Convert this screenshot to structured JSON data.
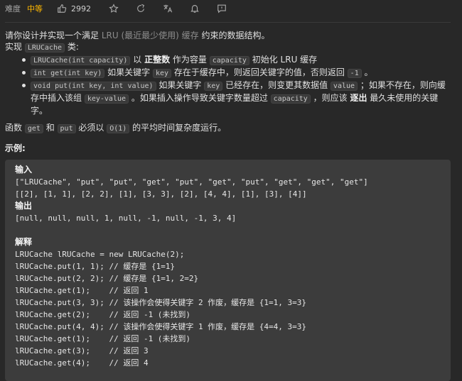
{
  "toolbar": {
    "difficulty_label": "难度",
    "difficulty_value": "中等",
    "likes": "2992",
    "icons": [
      "thumb-up-icon",
      "star-icon",
      "share-icon",
      "translate-icon",
      "bell-icon",
      "feedback-icon"
    ]
  },
  "description": {
    "l1_a": "请你设计并实现一个满足 ",
    "l1_b": "LRU (最近最少使用) 缓存",
    "l1_c": " 约束的数据结构。",
    "l2_a": "实现 ",
    "l2_code": "LRUCache",
    "l2_b": " 类:",
    "b1_code1": "LRUCache(int capacity)",
    "b1_a": " 以 ",
    "b1_bold": "正整数",
    "b1_b": " 作为容量 ",
    "b1_code2": "capacity",
    "b1_c": " 初始化 LRU 缓存",
    "b2_code1": "int get(int key)",
    "b2_a": " 如果关键字 ",
    "b2_code2": "key",
    "b2_b": " 存在于缓存中，则返回关键字的值，否则返回 ",
    "b2_code3": "-1",
    "b2_c": " 。",
    "b3_code1": "void put(int key, int value)",
    "b3_a": " 如果关键字 ",
    "b3_code2": "key",
    "b3_b": " 已经存在，则变更其数据值 ",
    "b3_code3": "value",
    "b3_c": " ；如果不存在，则向缓存中插入该组 ",
    "b3_code4": "key-value",
    "b3_d": " 。如果插入操作导致关键字数量超过 ",
    "b3_code5": "capacity",
    "b3_e": " ，则应该 ",
    "b3_bold": "逐出",
    "b3_f": " 最久未使用的关键字。",
    "l4_a": "函数 ",
    "l4_code1": "get",
    "l4_b": " 和 ",
    "l4_code2": "put",
    "l4_c": " 必须以 ",
    "l4_code3": "O(1)",
    "l4_d": " 的平均时间复杂度运行。"
  },
  "example": {
    "title": "示例:",
    "input_heading": "输入",
    "input_line1": "[\"LRUCache\", \"put\", \"put\", \"get\", \"put\", \"get\", \"put\", \"get\", \"get\", \"get\"]",
    "input_line2": "[[2], [1, 1], [2, 2], [1], [3, 3], [2], [4, 4], [1], [3], [4]]",
    "output_heading": "输出",
    "output_line": "[null, null, null, 1, null, -1, null, -1, 3, 4]",
    "explain_heading": "解释",
    "explain_lines": [
      "LRUCache lRUCache = new LRUCache(2);",
      "lRUCache.put(1, 1); // 缓存是 {1=1}",
      "lRUCache.put(2, 2); // 缓存是 {1=1, 2=2}",
      "lRUCache.get(1);    // 返回 1",
      "lRUCache.put(3, 3); // 该操作会使得关键字 2 作废，缓存是 {1=1, 3=3}",
      "lRUCache.get(2);    // 返回 -1 (未找到)",
      "lRUCache.put(4, 4); // 该操作会使得关键字 1 作废，缓存是 {4=4, 3=3}",
      "lRUCache.get(1);    // 返回 -1 (未找到)",
      "lRUCache.get(3);    // 返回 3",
      "lRUCache.get(4);    // 返回 4"
    ]
  }
}
